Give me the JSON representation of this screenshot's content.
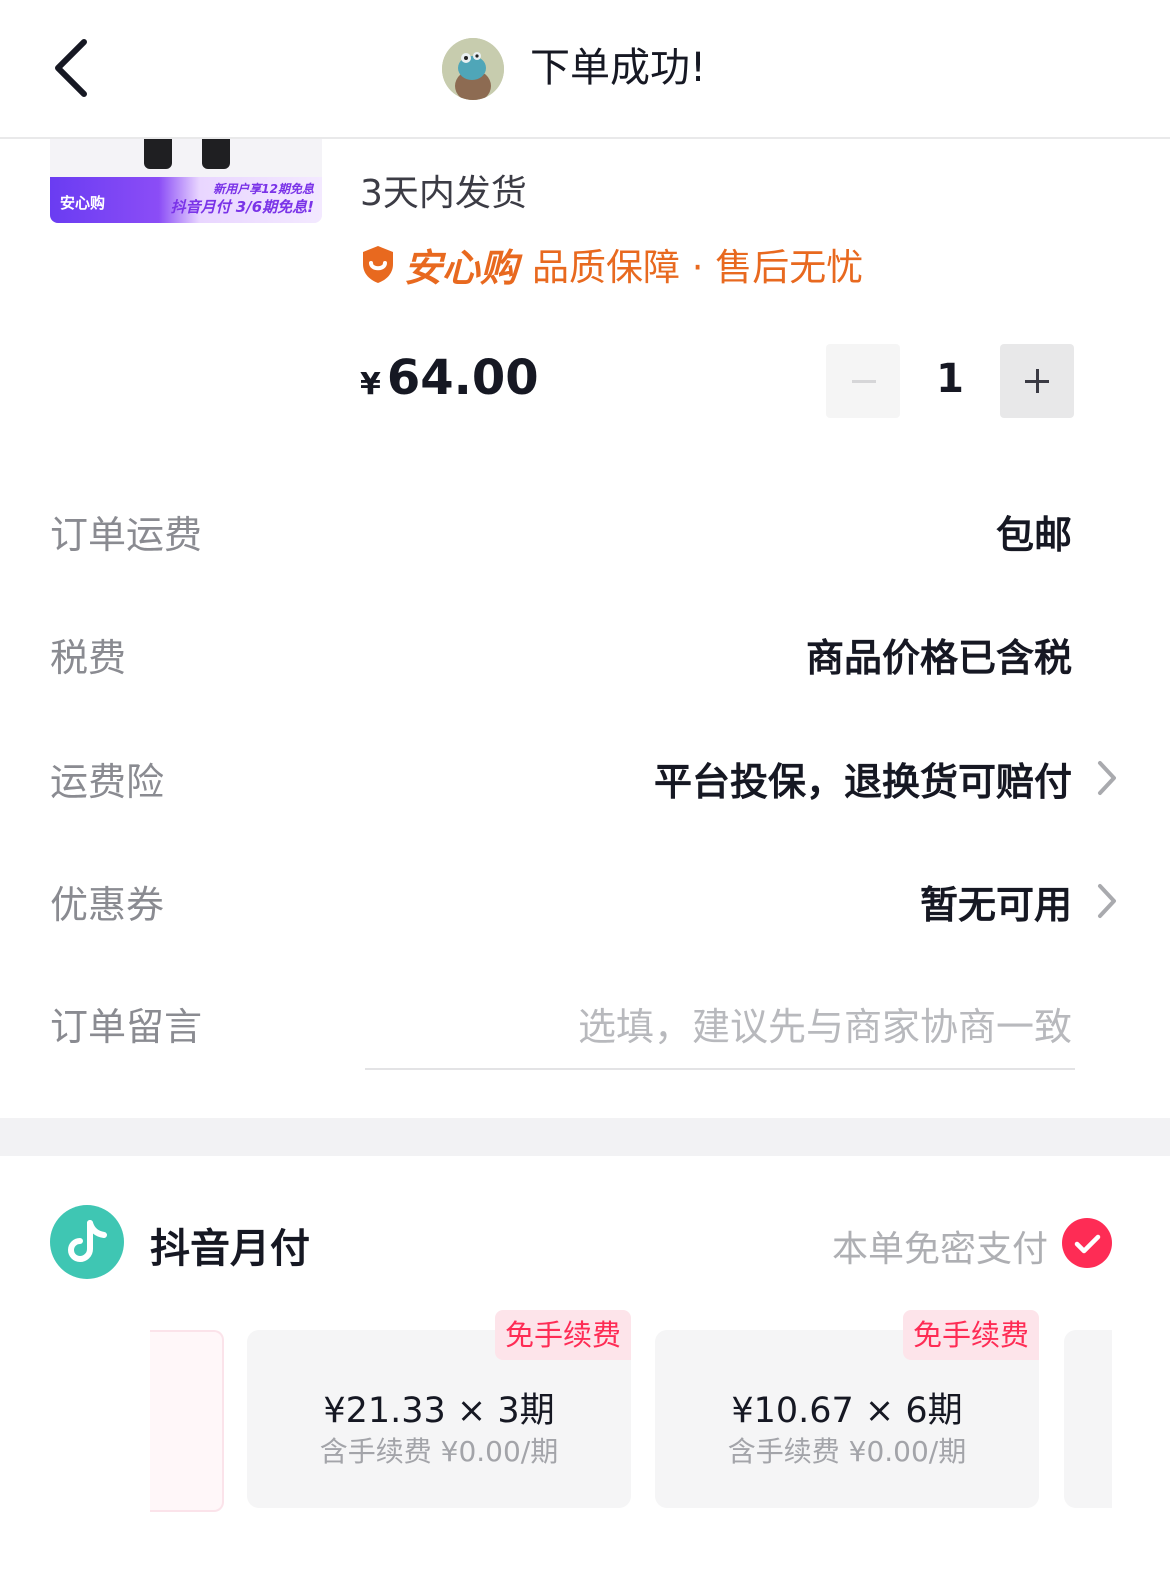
{
  "header": {
    "title": "下单成功!"
  },
  "product": {
    "thumb_badge": "安心购",
    "thumb_promo_top": "新用户享12期免息",
    "thumb_promo_bottom": "抖音月付 3/6期免息!",
    "ship_time": "3天内发货",
    "guarantee_brand": "安心购",
    "guarantee_text": "品质保障 · 售后无忧",
    "price_currency": "¥",
    "price_amount": "64.00",
    "quantity": "1",
    "accent_color": "#e8691f"
  },
  "order_rows": [
    {
      "label": "订单运费",
      "value": "包邮"
    },
    {
      "label": "税费",
      "value": "商品价格已含税"
    },
    {
      "label": "运费险",
      "value": "平台投保，退换货可赔付"
    },
    {
      "label": "优惠券",
      "value": "暂无可用"
    }
  ],
  "note": {
    "label": "订单留言",
    "placeholder": "选填，建议先与商家协商一致"
  },
  "payment": {
    "title": "抖音月付",
    "no_password": "本单免密支付",
    "brand_color": "#fe2c55",
    "plans": [
      {
        "tag": "免手续费",
        "main": "¥21.33 × 3期",
        "sub": "含手续费 ¥0.00/期"
      },
      {
        "tag": "免手续费",
        "main": "¥10.67 × 6期",
        "sub": "含手续费 ¥0.00/期"
      }
    ]
  },
  "icons": [
    "back-icon",
    "avatar",
    "shield-icon",
    "chevron-right-icon",
    "douyin-logo-icon",
    "check-icon"
  ]
}
